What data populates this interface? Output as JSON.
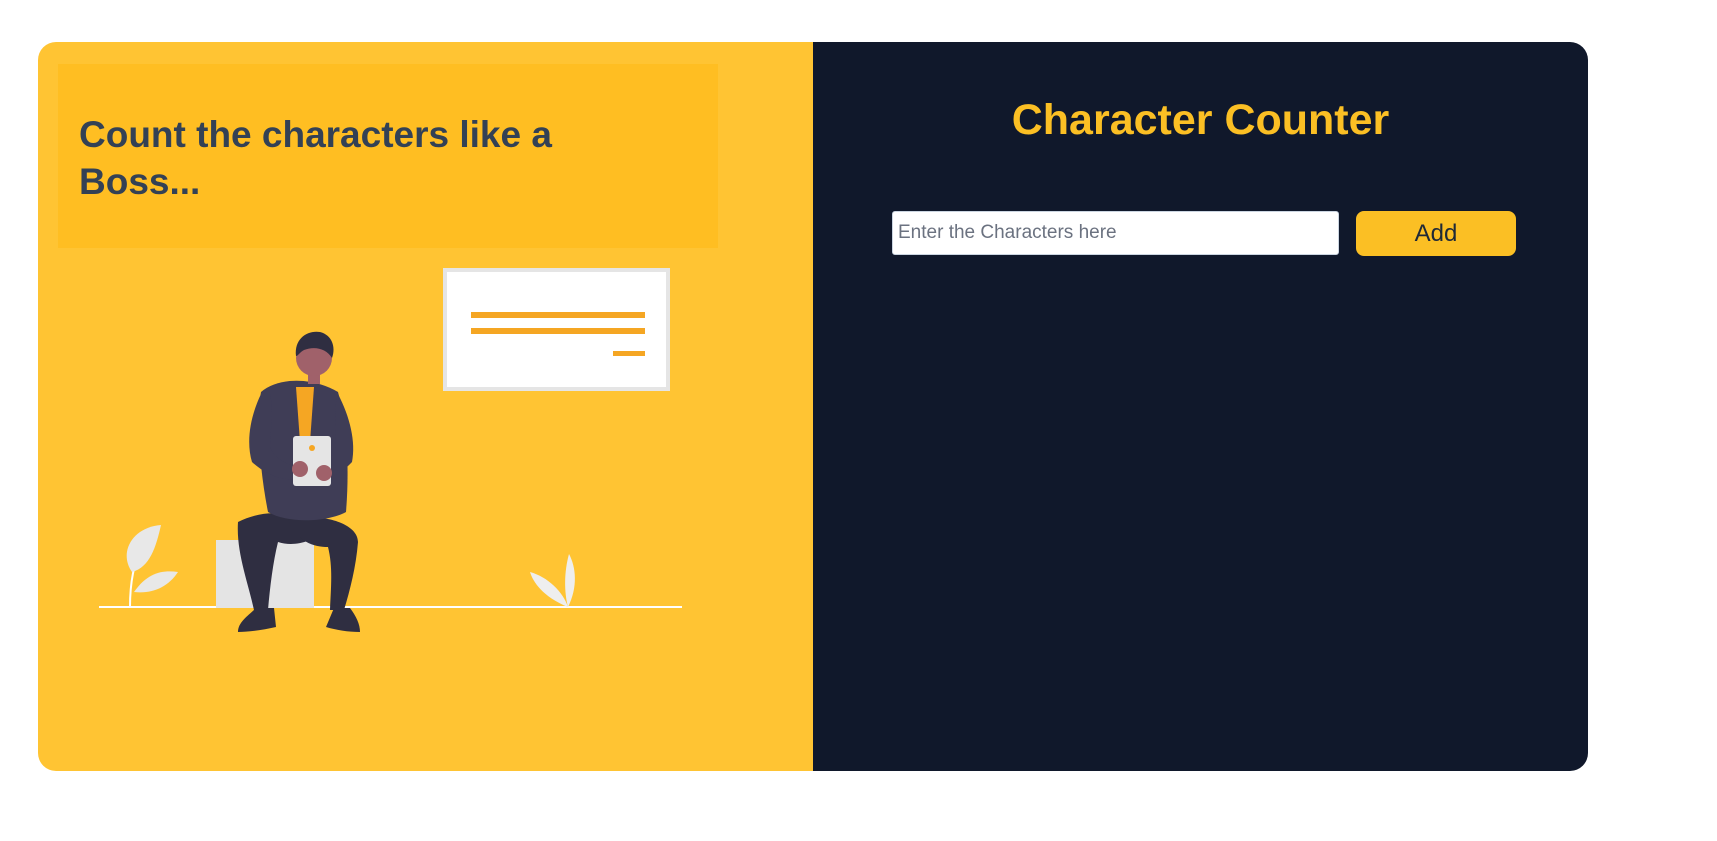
{
  "hero": {
    "headline": "Count the characters like a Boss..."
  },
  "app": {
    "title": "Character Counter",
    "input_value": "",
    "input_placeholder": "Enter the Characters here",
    "add_label": "Add"
  },
  "colors": {
    "left_bg": "#ffc433",
    "headline_box_bg": "#ffbe22",
    "headline_text": "#334155",
    "right_bg": "#10182b",
    "accent": "#fbbf24"
  },
  "icons": [
    "person-with-tablet-illustration",
    "whiteboard-icon",
    "leaf-plant-icon"
  ]
}
